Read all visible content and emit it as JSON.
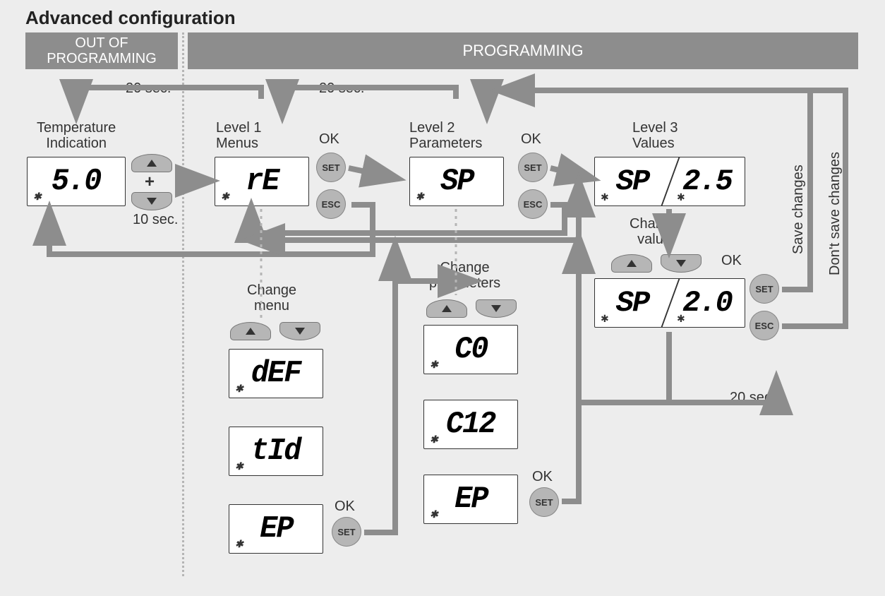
{
  "title": "Advanced configuration",
  "header": {
    "out": "OUT OF\nPROGRAMMING",
    "prog": "PROGRAMMING"
  },
  "timeouts": {
    "t20": "20 sec.",
    "t10": "10 sec."
  },
  "labels": {
    "temp": "Temperature\nIndication",
    "l1": "Level 1\nMenus",
    "l2": "Level 2\nParameters",
    "l3": "Level 3\nValues",
    "chmenu": "Change\nmenu",
    "chparam": "Change\nparameters",
    "chvalue": "Change\nvalue",
    "ok": "OK",
    "save": "Save changes",
    "nosave": "Don't save changes"
  },
  "buttons": {
    "set": "SET",
    "esc": "ESC"
  },
  "displays": {
    "temp": "5.0",
    "l1": "rE",
    "l2": "SP",
    "l3a": "SP",
    "l3b": "2.5",
    "menu1": "dEF",
    "menu2": "tId",
    "menu3": "EP",
    "par1": "C0",
    "par2": "C12",
    "par3": "EP",
    "val2a": "SP",
    "val2b": "2.0"
  }
}
